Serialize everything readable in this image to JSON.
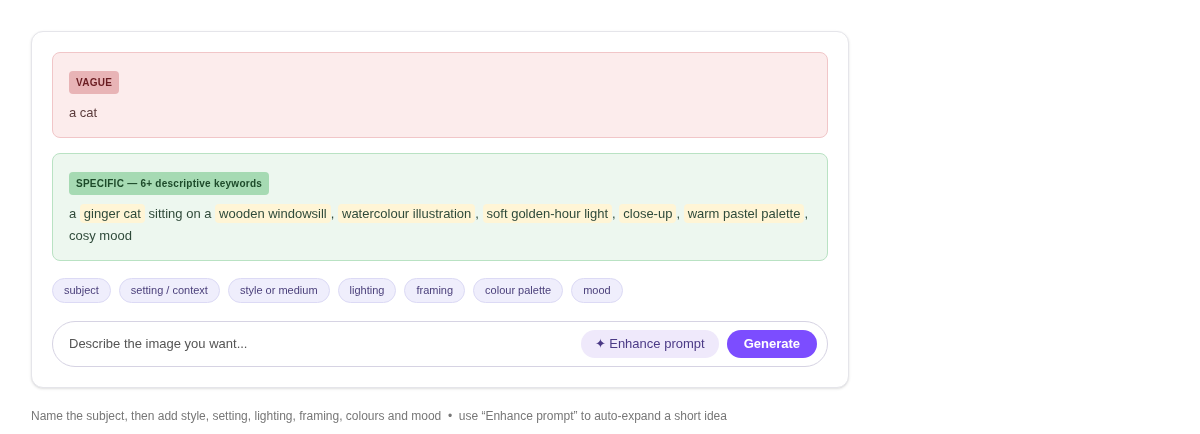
{
  "examples": [
    {
      "kind": "vague",
      "badge": "VAGUE",
      "segments": [
        {
          "kind": "plain",
          "text": "a cat"
        }
      ]
    },
    {
      "kind": "specific",
      "badge": "SPECIFIC — 6+ descriptive keywords",
      "segments": [
        {
          "kind": "plain",
          "text": "a"
        },
        {
          "kind": "keyword",
          "text": "ginger cat"
        },
        {
          "kind": "plain",
          "text": "sitting on a"
        },
        {
          "kind": "keyword",
          "text": "wooden windowsill"
        },
        {
          "kind": "plain",
          "text": ","
        },
        {
          "kind": "keyword",
          "text": "watercolour illustration"
        },
        {
          "kind": "plain",
          "text": ","
        },
        {
          "kind": "keyword",
          "text": "soft golden-hour light"
        },
        {
          "kind": "plain",
          "text": ","
        },
        {
          "kind": "keyword",
          "text": "close-up"
        },
        {
          "kind": "plain",
          "text": ","
        },
        {
          "kind": "keyword",
          "text": "warm pastel palette"
        },
        {
          "kind": "plain",
          "text": ","
        },
        {
          "kind": "plain",
          "text": "cosy mood"
        }
      ]
    }
  ],
  "chips": [
    "subject",
    "setting / context",
    "style or medium",
    "lighting",
    "framing",
    "colour palette",
    "mood"
  ],
  "prompt": {
    "placeholder": "Describe the image you want...",
    "enhance_icon": "✦",
    "enhance_label": "Enhance prompt",
    "generate_label": "Generate"
  },
  "hint": "Name the subject, then add style, setting, lighting, framing, colours and mood  •  use “Enhance prompt” to auto-expand a short idea"
}
